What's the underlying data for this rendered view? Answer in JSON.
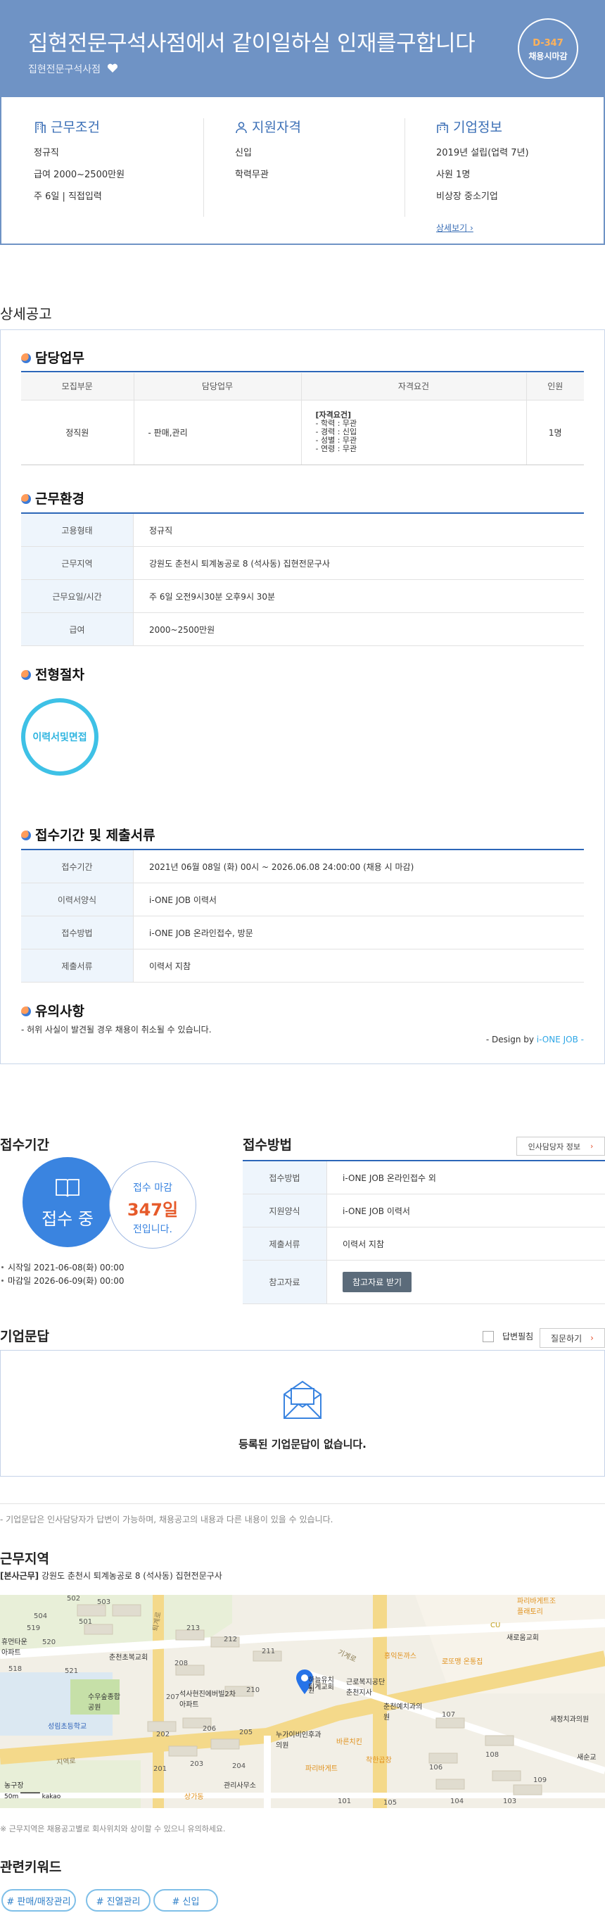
{
  "header": {
    "title": "집현전문구석사점에서 같이일하실 인재를구합니다",
    "company": "집현전문구석사점",
    "dday": "D-347",
    "dday_caption": "채용시마감"
  },
  "summary": {
    "work": {
      "title": "근무조건",
      "lines": [
        "정규직",
        "급여 2000~2500만원",
        "주 6일 | 직접입력"
      ]
    },
    "qual": {
      "title": "지원자격",
      "lines": [
        "신입",
        "학력무관"
      ]
    },
    "company": {
      "title": "기업정보",
      "lines": [
        "2019년 설립(업력 7년)",
        "사원 1명",
        "비상장 중소기업"
      ],
      "more": "상세보기"
    }
  },
  "detail": {
    "title": "상세공고",
    "duty": {
      "title": "담당업무",
      "headers": [
        "모집부문",
        "담당업무",
        "자격요건",
        "인원"
      ],
      "row": {
        "dept": "정직원",
        "task": "- 판매,관리",
        "qual_head": "[자격요건]",
        "qual_lines": [
          "- 학력 : 무관",
          "- 경력 : 신입",
          "- 성별 : 무관",
          "- 연령 : 무관"
        ],
        "count": "1명"
      }
    },
    "env": {
      "title": "근무환경",
      "rows": [
        {
          "k": "고용형태",
          "v": "정규직"
        },
        {
          "k": "근무지역",
          "v": "강원도 춘천시 퇴계농공로 8 (석사동) 집현전문구사"
        },
        {
          "k": "근무요일/시간",
          "v": "주 6일 오전9시30분 오후9시 30분"
        },
        {
          "k": "급여",
          "v": "2000~2500만원"
        }
      ]
    },
    "process": {
      "title": "전형절차",
      "step": "이력서및면접"
    },
    "period": {
      "title": "접수기간 및 제출서류",
      "rows": [
        {
          "k": "접수기간",
          "v": "2021년 06월 08일 (화) 00시 ~ 2026.06.08 24:00:00 (채용 시 마감)"
        },
        {
          "k": "이력서양식",
          "v": "i-ONE JOB 이력서"
        },
        {
          "k": "접수방법",
          "v": "i-ONE JOB 온라인접수, 방문"
        },
        {
          "k": "제출서류",
          "v": "이력서 지참"
        }
      ]
    },
    "notice": {
      "title": "유의사항",
      "text": "- 허위 사실이 발견될 경우 채용이 취소될 수 있습니다."
    },
    "design_prefix": "- Design by ",
    "design_brand": "i-ONE JOB",
    "design_suffix": " -"
  },
  "apply": {
    "period_title": "접수기간",
    "status": "접수 중",
    "deadline_pre": "접수 마감",
    "deadline_days": "347일",
    "deadline_post": "전입니다.",
    "start": "시작일 2021-06-08(화) 00:00",
    "end": "마감일 2026-06-09(화) 00:00",
    "method_title": "접수방법",
    "hr_button": "인사담당자 정보",
    "method_rows": [
      {
        "k": "접수방법",
        "v": "i-ONE JOB 온라인접수 외"
      },
      {
        "k": "지원양식",
        "v": "i-ONE JOB 이력서"
      },
      {
        "k": "제출서류",
        "v": "이력서 지참"
      }
    ],
    "ref_label": "참고자료",
    "ref_button": "참고자료 받기"
  },
  "qna": {
    "title": "기업문답",
    "checkbox_label": "답변필침",
    "ask_button": "질문하기",
    "empty": "등록된 기업문답이 없습니다.",
    "note": "- 기업문답은 인사담당자가 답변이 가능하며, 채용공고의 내용과 다른 내용이 있을 수 있습니다."
  },
  "location": {
    "title": "근무지역",
    "addr_tag": "[본사근무]",
    "addr": " 강원도 춘천시 퇴계농공로 8 (석사동) 집현전문구사",
    "map_labels": [
      "502",
      "503",
      "504",
      "501",
      "519",
      "520",
      "518",
      "521",
      "213",
      "212",
      "211",
      "208",
      "207",
      "210",
      "206",
      "205",
      "202",
      "201",
      "203",
      "204",
      "107",
      "106",
      "108",
      "109",
      "101",
      "105",
      "104",
      "103",
      "휴먼타운아파트",
      "춘천초복교회",
      "수우숲종합공원",
      "성림초등학교",
      "석사현진에버빌2차아파트",
      "관리사무소",
      "상가동",
      "하늘유치원",
      "퇴계교회",
      "근로복지공단춘천지사",
      "춘천예치과의원",
      "누가이비인후과의원",
      "바른치킨",
      "파리바게트",
      "착한곱창",
      "세정치과의원",
      "홍익돈까스",
      "로또맹 온통집",
      "CU",
      "새로움교회",
      "파리바게트조플래토리",
      "퇴계로",
      "기계로",
      "지역로",
      "새순교",
      "농구장",
      "50m",
      "kakao"
    ],
    "map_note": "※ 근무지역은 채용공고별로 회사위치와 상이할 수 있으니 유의하세요."
  },
  "keywords": {
    "title": "관련키워드",
    "items": [
      "# 판매/매장관리",
      "# 진열관리",
      "# 신입"
    ]
  },
  "colors": {
    "accent": "#3b6fb6",
    "banner": "#6f93c5",
    "orange": "#e65a2a",
    "sky": "#3ec1e6"
  }
}
